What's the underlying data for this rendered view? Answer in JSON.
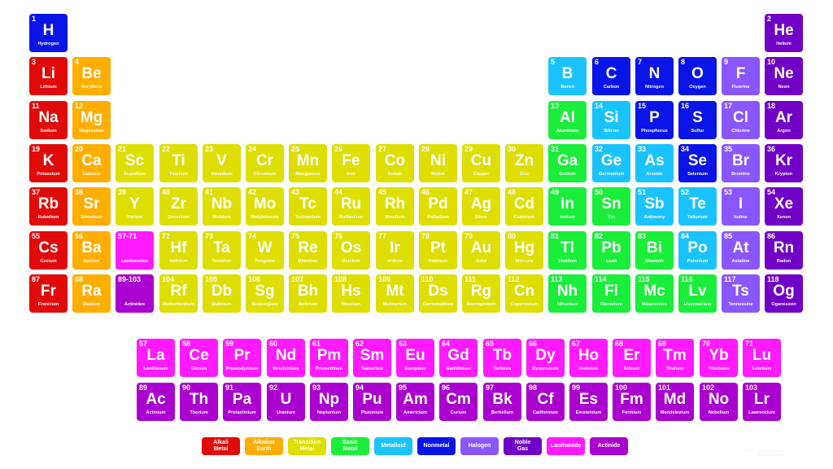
{
  "categories": {
    "alkali": {
      "label": "Alkali\nMetal",
      "color": "#e10a0a"
    },
    "alkaline": {
      "label": "Alkaline\nEarth",
      "color": "#ffae00"
    },
    "transition": {
      "label": "Transition\nMetal",
      "color": "#dede00"
    },
    "basic": {
      "label": "Basic\nMetal",
      "color": "#1aee3a"
    },
    "metalloid": {
      "label": "Metalloid",
      "color": "#1ac3ff"
    },
    "nonmetal": {
      "label": "Nonmetal",
      "color": "#0a14e6"
    },
    "halogen": {
      "label": "Halogen",
      "color": "#8a57ff"
    },
    "noble": {
      "label": "Noble\nGas",
      "color": "#7000c6"
    },
    "lanthanide": {
      "label": "Lanthanide",
      "color": "#ff1aff"
    },
    "actinide": {
      "label": "Actinide",
      "color": "#aa00d0"
    }
  },
  "legend_order": [
    "alkali",
    "alkaline",
    "transition",
    "basic",
    "metalloid",
    "nonmetal",
    "halogen",
    "noble",
    "lanthanide",
    "actinide"
  ],
  "elements": [
    {
      "n": "1",
      "s": "H",
      "name": "Hydrogen",
      "c": "nonmetal",
      "col": 1,
      "row": 1
    },
    {
      "n": "2",
      "s": "He",
      "name": "Helium",
      "c": "noble",
      "col": 18,
      "row": 1
    },
    {
      "n": "3",
      "s": "Li",
      "name": "Lithium",
      "c": "alkali",
      "col": 1,
      "row": 2
    },
    {
      "n": "4",
      "s": "Be",
      "name": "Beryllium",
      "c": "alkaline",
      "col": 2,
      "row": 2
    },
    {
      "n": "5",
      "s": "B",
      "name": "Boron",
      "c": "metalloid",
      "col": 13,
      "row": 2
    },
    {
      "n": "6",
      "s": "C",
      "name": "Carbon",
      "c": "nonmetal",
      "col": 14,
      "row": 2
    },
    {
      "n": "7",
      "s": "N",
      "name": "Nitrogen",
      "c": "nonmetal",
      "col": 15,
      "row": 2
    },
    {
      "n": "8",
      "s": "O",
      "name": "Oxygen",
      "c": "nonmetal",
      "col": 16,
      "row": 2
    },
    {
      "n": "9",
      "s": "F",
      "name": "Fluorine",
      "c": "halogen",
      "col": 17,
      "row": 2
    },
    {
      "n": "10",
      "s": "Ne",
      "name": "Neon",
      "c": "noble",
      "col": 18,
      "row": 2
    },
    {
      "n": "11",
      "s": "Na",
      "name": "Sodium",
      "c": "alkali",
      "col": 1,
      "row": 3
    },
    {
      "n": "12",
      "s": "Mg",
      "name": "Magnesium",
      "c": "alkaline",
      "col": 2,
      "row": 3
    },
    {
      "n": "13",
      "s": "Al",
      "name": "Aluminum",
      "c": "basic",
      "col": 13,
      "row": 3
    },
    {
      "n": "14",
      "s": "Si",
      "name": "Silicon",
      "c": "metalloid",
      "col": 14,
      "row": 3
    },
    {
      "n": "15",
      "s": "P",
      "name": "Phosphorus",
      "c": "nonmetal",
      "col": 15,
      "row": 3
    },
    {
      "n": "16",
      "s": "S",
      "name": "Sulfur",
      "c": "nonmetal",
      "col": 16,
      "row": 3
    },
    {
      "n": "17",
      "s": "Cl",
      "name": "Chlorine",
      "c": "halogen",
      "col": 17,
      "row": 3
    },
    {
      "n": "18",
      "s": "Ar",
      "name": "Argon",
      "c": "noble",
      "col": 18,
      "row": 3
    },
    {
      "n": "19",
      "s": "K",
      "name": "Potassium",
      "c": "alkali",
      "col": 1,
      "row": 4
    },
    {
      "n": "20",
      "s": "Ca",
      "name": "Calcium",
      "c": "alkaline",
      "col": 2,
      "row": 4
    },
    {
      "n": "21",
      "s": "Sc",
      "name": "Scandium",
      "c": "transition",
      "col": 3,
      "row": 4
    },
    {
      "n": "22",
      "s": "Ti",
      "name": "Titanium",
      "c": "transition",
      "col": 4,
      "row": 4
    },
    {
      "n": "23",
      "s": "V",
      "name": "Vanadium",
      "c": "transition",
      "col": 5,
      "row": 4
    },
    {
      "n": "24",
      "s": "Cr",
      "name": "Chromium",
      "c": "transition",
      "col": 6,
      "row": 4
    },
    {
      "n": "25",
      "s": "Mn",
      "name": "Manganese",
      "c": "transition",
      "col": 7,
      "row": 4
    },
    {
      "n": "26",
      "s": "Fe",
      "name": "Iron",
      "c": "transition",
      "col": 8,
      "row": 4
    },
    {
      "n": "27",
      "s": "Co",
      "name": "Cobalt",
      "c": "transition",
      "col": 9,
      "row": 4
    },
    {
      "n": "28",
      "s": "Ni",
      "name": "Nickel",
      "c": "transition",
      "col": 10,
      "row": 4
    },
    {
      "n": "29",
      "s": "Cu",
      "name": "Copper",
      "c": "transition",
      "col": 11,
      "row": 4
    },
    {
      "n": "30",
      "s": "Zn",
      "name": "Zinc",
      "c": "transition",
      "col": 12,
      "row": 4
    },
    {
      "n": "31",
      "s": "Ga",
      "name": "Gallium",
      "c": "basic",
      "col": 13,
      "row": 4
    },
    {
      "n": "32",
      "s": "Ge",
      "name": "Germanium",
      "c": "metalloid",
      "col": 14,
      "row": 4
    },
    {
      "n": "33",
      "s": "As",
      "name": "Arsenic",
      "c": "metalloid",
      "col": 15,
      "row": 4
    },
    {
      "n": "34",
      "s": "Se",
      "name": "Selenium",
      "c": "nonmetal",
      "col": 16,
      "row": 4
    },
    {
      "n": "35",
      "s": "Br",
      "name": "Bromine",
      "c": "halogen",
      "col": 17,
      "row": 4
    },
    {
      "n": "36",
      "s": "Kr",
      "name": "Krypton",
      "c": "noble",
      "col": 18,
      "row": 4
    },
    {
      "n": "37",
      "s": "Rb",
      "name": "Rubidium",
      "c": "alkali",
      "col": 1,
      "row": 5
    },
    {
      "n": "38",
      "s": "Sr",
      "name": "Strontium",
      "c": "alkaline",
      "col": 2,
      "row": 5
    },
    {
      "n": "39",
      "s": "Y",
      "name": "Yttrium",
      "c": "transition",
      "col": 3,
      "row": 5
    },
    {
      "n": "40",
      "s": "Zr",
      "name": "Zirconium",
      "c": "transition",
      "col": 4,
      "row": 5
    },
    {
      "n": "41",
      "s": "Nb",
      "name": "Niobium",
      "c": "transition",
      "col": 5,
      "row": 5
    },
    {
      "n": "42",
      "s": "Mo",
      "name": "Molybdenum",
      "c": "transition",
      "col": 6,
      "row": 5
    },
    {
      "n": "43",
      "s": "Tc",
      "name": "Technetium",
      "c": "transition",
      "col": 7,
      "row": 5
    },
    {
      "n": "44",
      "s": "Ru",
      "name": "Ruthenium",
      "c": "transition",
      "col": 8,
      "row": 5
    },
    {
      "n": "45",
      "s": "Rh",
      "name": "Rhodium",
      "c": "transition",
      "col": 9,
      "row": 5
    },
    {
      "n": "46",
      "s": "Pd",
      "name": "Palladium",
      "c": "transition",
      "col": 10,
      "row": 5
    },
    {
      "n": "47",
      "s": "Ag",
      "name": "Silver",
      "c": "transition",
      "col": 11,
      "row": 5
    },
    {
      "n": "48",
      "s": "Cd",
      "name": "Cadmium",
      "c": "transition",
      "col": 12,
      "row": 5
    },
    {
      "n": "49",
      "s": "In",
      "name": "Indium",
      "c": "basic",
      "col": 13,
      "row": 5
    },
    {
      "n": "50",
      "s": "Sn",
      "name": "Tin",
      "c": "basic",
      "col": 14,
      "row": 5
    },
    {
      "n": "51",
      "s": "Sb",
      "name": "Antimony",
      "c": "metalloid",
      "col": 15,
      "row": 5
    },
    {
      "n": "52",
      "s": "Te",
      "name": "Tellurium",
      "c": "metalloid",
      "col": 16,
      "row": 5
    },
    {
      "n": "53",
      "s": "I",
      "name": "Iodine",
      "c": "halogen",
      "col": 17,
      "row": 5
    },
    {
      "n": "54",
      "s": "Xe",
      "name": "Xenon",
      "c": "noble",
      "col": 18,
      "row": 5
    },
    {
      "n": "55",
      "s": "Cs",
      "name": "Cesium",
      "c": "alkali",
      "col": 1,
      "row": 6
    },
    {
      "n": "56",
      "s": "Ba",
      "name": "Barium",
      "c": "alkaline",
      "col": 2,
      "row": 6
    },
    {
      "n": "57-71",
      "s": "",
      "name": "Lanthanides",
      "c": "lanthanide",
      "col": 3,
      "row": 6,
      "placeholder": true
    },
    {
      "n": "72",
      "s": "Hf",
      "name": "Hafnium",
      "c": "transition",
      "col": 4,
      "row": 6
    },
    {
      "n": "73",
      "s": "Ta",
      "name": "Tantalum",
      "c": "transition",
      "col": 5,
      "row": 6
    },
    {
      "n": "74",
      "s": "W",
      "name": "Tungsten",
      "c": "transition",
      "col": 6,
      "row": 6
    },
    {
      "n": "75",
      "s": "Re",
      "name": "Rhenium",
      "c": "transition",
      "col": 7,
      "row": 6
    },
    {
      "n": "76",
      "s": "Os",
      "name": "Osmium",
      "c": "transition",
      "col": 8,
      "row": 6
    },
    {
      "n": "77",
      "s": "Ir",
      "name": "Iridium",
      "c": "transition",
      "col": 9,
      "row": 6
    },
    {
      "n": "78",
      "s": "Pt",
      "name": "Platinum",
      "c": "transition",
      "col": 10,
      "row": 6
    },
    {
      "n": "79",
      "s": "Au",
      "name": "Gold",
      "c": "transition",
      "col": 11,
      "row": 6
    },
    {
      "n": "80",
      "s": "Hg",
      "name": "Mercury",
      "c": "transition",
      "col": 12,
      "row": 6
    },
    {
      "n": "81",
      "s": "Tl",
      "name": "Thallium",
      "c": "basic",
      "col": 13,
      "row": 6
    },
    {
      "n": "82",
      "s": "Pb",
      "name": "Lead",
      "c": "basic",
      "col": 14,
      "row": 6
    },
    {
      "n": "83",
      "s": "Bi",
      "name": "Bismuth",
      "c": "basic",
      "col": 15,
      "row": 6
    },
    {
      "n": "84",
      "s": "Po",
      "name": "Polonium",
      "c": "metalloid",
      "col": 16,
      "row": 6
    },
    {
      "n": "85",
      "s": "At",
      "name": "Astatine",
      "c": "halogen",
      "col": 17,
      "row": 6
    },
    {
      "n": "86",
      "s": "Rn",
      "name": "Radon",
      "c": "noble",
      "col": 18,
      "row": 6
    },
    {
      "n": "87",
      "s": "Fr",
      "name": "Francium",
      "c": "alkali",
      "col": 1,
      "row": 7
    },
    {
      "n": "88",
      "s": "Ra",
      "name": "Radium",
      "c": "alkaline",
      "col": 2,
      "row": 7
    },
    {
      "n": "89-103",
      "s": "",
      "name": "Actinides",
      "c": "actinide",
      "col": 3,
      "row": 7,
      "placeholder": true
    },
    {
      "n": "104",
      "s": "Rf",
      "name": "Rutherfordium",
      "c": "transition",
      "col": 4,
      "row": 7
    },
    {
      "n": "105",
      "s": "Db",
      "name": "Dubnium",
      "c": "transition",
      "col": 5,
      "row": 7
    },
    {
      "n": "106",
      "s": "Sg",
      "name": "Seaborgium",
      "c": "transition",
      "col": 6,
      "row": 7
    },
    {
      "n": "107",
      "s": "Bh",
      "name": "Bohrium",
      "c": "transition",
      "col": 7,
      "row": 7
    },
    {
      "n": "108",
      "s": "Hs",
      "name": "Hassium",
      "c": "transition",
      "col": 8,
      "row": 7
    },
    {
      "n": "109",
      "s": "Mt",
      "name": "Meitnerium",
      "c": "transition",
      "col": 9,
      "row": 7
    },
    {
      "n": "110",
      "s": "Ds",
      "name": "Darmstadtium",
      "c": "transition",
      "col": 10,
      "row": 7
    },
    {
      "n": "111",
      "s": "Rg",
      "name": "Roentgenium",
      "c": "transition",
      "col": 11,
      "row": 7
    },
    {
      "n": "112",
      "s": "Cn",
      "name": "Copernicium",
      "c": "transition",
      "col": 12,
      "row": 7
    },
    {
      "n": "113",
      "s": "Nh",
      "name": "Nihonium",
      "c": "basic",
      "col": 13,
      "row": 7
    },
    {
      "n": "114",
      "s": "Fl",
      "name": "Flerovium",
      "c": "basic",
      "col": 14,
      "row": 7
    },
    {
      "n": "115",
      "s": "Mc",
      "name": "Moscovium",
      "c": "basic",
      "col": 15,
      "row": 7
    },
    {
      "n": "116",
      "s": "Lv",
      "name": "Livermorium",
      "c": "basic",
      "col": 16,
      "row": 7
    },
    {
      "n": "117",
      "s": "Ts",
      "name": "Tennessine",
      "c": "halogen",
      "col": 17,
      "row": 7
    },
    {
      "n": "118",
      "s": "Og",
      "name": "Oganesson",
      "c": "noble",
      "col": 18,
      "row": 7
    },
    {
      "n": "57",
      "s": "La",
      "name": "Lanthanum",
      "c": "lanthanide",
      "col": 1,
      "row": 9
    },
    {
      "n": "58",
      "s": "Ce",
      "name": "Cerium",
      "c": "lanthanide",
      "col": 2,
      "row": 9
    },
    {
      "n": "59",
      "s": "Pr",
      "name": "Praseodymium",
      "c": "lanthanide",
      "col": 3,
      "row": 9
    },
    {
      "n": "60",
      "s": "Nd",
      "name": "Neodymium",
      "c": "lanthanide",
      "col": 4,
      "row": 9
    },
    {
      "n": "61",
      "s": "Pm",
      "name": "Promethium",
      "c": "lanthanide",
      "col": 5,
      "row": 9
    },
    {
      "n": "62",
      "s": "Sm",
      "name": "Samarium",
      "c": "lanthanide",
      "col": 6,
      "row": 9
    },
    {
      "n": "63",
      "s": "Eu",
      "name": "Europium",
      "c": "lanthanide",
      "col": 7,
      "row": 9
    },
    {
      "n": "64",
      "s": "Gd",
      "name": "Gadolinium",
      "c": "lanthanide",
      "col": 8,
      "row": 9
    },
    {
      "n": "65",
      "s": "Tb",
      "name": "Terbium",
      "c": "lanthanide",
      "col": 9,
      "row": 9
    },
    {
      "n": "66",
      "s": "Dy",
      "name": "Dysprosium",
      "c": "lanthanide",
      "col": 10,
      "row": 9
    },
    {
      "n": "67",
      "s": "Ho",
      "name": "Holmium",
      "c": "lanthanide",
      "col": 11,
      "row": 9
    },
    {
      "n": "68",
      "s": "Er",
      "name": "Erbium",
      "c": "lanthanide",
      "col": 12,
      "row": 9
    },
    {
      "n": "69",
      "s": "Tm",
      "name": "Thulium",
      "c": "lanthanide",
      "col": 13,
      "row": 9
    },
    {
      "n": "70",
      "s": "Yb",
      "name": "Ytterbium",
      "c": "lanthanide",
      "col": 14,
      "row": 9
    },
    {
      "n": "71",
      "s": "Lu",
      "name": "Lutetium",
      "c": "lanthanide",
      "col": 15,
      "row": 9
    },
    {
      "n": "89",
      "s": "Ac",
      "name": "Actinium",
      "c": "actinide",
      "col": 1,
      "row": 10
    },
    {
      "n": "90",
      "s": "Th",
      "name": "Thorium",
      "c": "actinide",
      "col": 2,
      "row": 10
    },
    {
      "n": "91",
      "s": "Pa",
      "name": "Protactinium",
      "c": "actinide",
      "col": 3,
      "row": 10
    },
    {
      "n": "92",
      "s": "U",
      "name": "Uranium",
      "c": "actinide",
      "col": 4,
      "row": 10
    },
    {
      "n": "93",
      "s": "Np",
      "name": "Neptunium",
      "c": "actinide",
      "col": 5,
      "row": 10
    },
    {
      "n": "94",
      "s": "Pu",
      "name": "Plutonium",
      "c": "actinide",
      "col": 6,
      "row": 10
    },
    {
      "n": "95",
      "s": "Am",
      "name": "Americium",
      "c": "actinide",
      "col": 7,
      "row": 10
    },
    {
      "n": "96",
      "s": "Cm",
      "name": "Curium",
      "c": "actinide",
      "col": 8,
      "row": 10
    },
    {
      "n": "97",
      "s": "Bk",
      "name": "Berkelium",
      "c": "actinide",
      "col": 9,
      "row": 10
    },
    {
      "n": "98",
      "s": "Cf",
      "name": "Californium",
      "c": "actinide",
      "col": 10,
      "row": 10
    },
    {
      "n": "99",
      "s": "Es",
      "name": "Einsteinium",
      "c": "actinide",
      "col": 11,
      "row": 10
    },
    {
      "n": "100",
      "s": "Fm",
      "name": "Fermium",
      "c": "actinide",
      "col": 12,
      "row": 10
    },
    {
      "n": "101",
      "s": "Md",
      "name": "Mendelevium",
      "c": "actinide",
      "col": 13,
      "row": 10
    },
    {
      "n": "102",
      "s": "No",
      "name": "Nobelium",
      "c": "actinide",
      "col": 14,
      "row": 10
    },
    {
      "n": "103",
      "s": "Lr",
      "name": "Lawrencium",
      "c": "actinide",
      "col": 15,
      "row": 10
    }
  ],
  "watermark": {
    "line1": "©2017 Todd Helmenstine",
    "line2": "sciencenotes.org"
  }
}
